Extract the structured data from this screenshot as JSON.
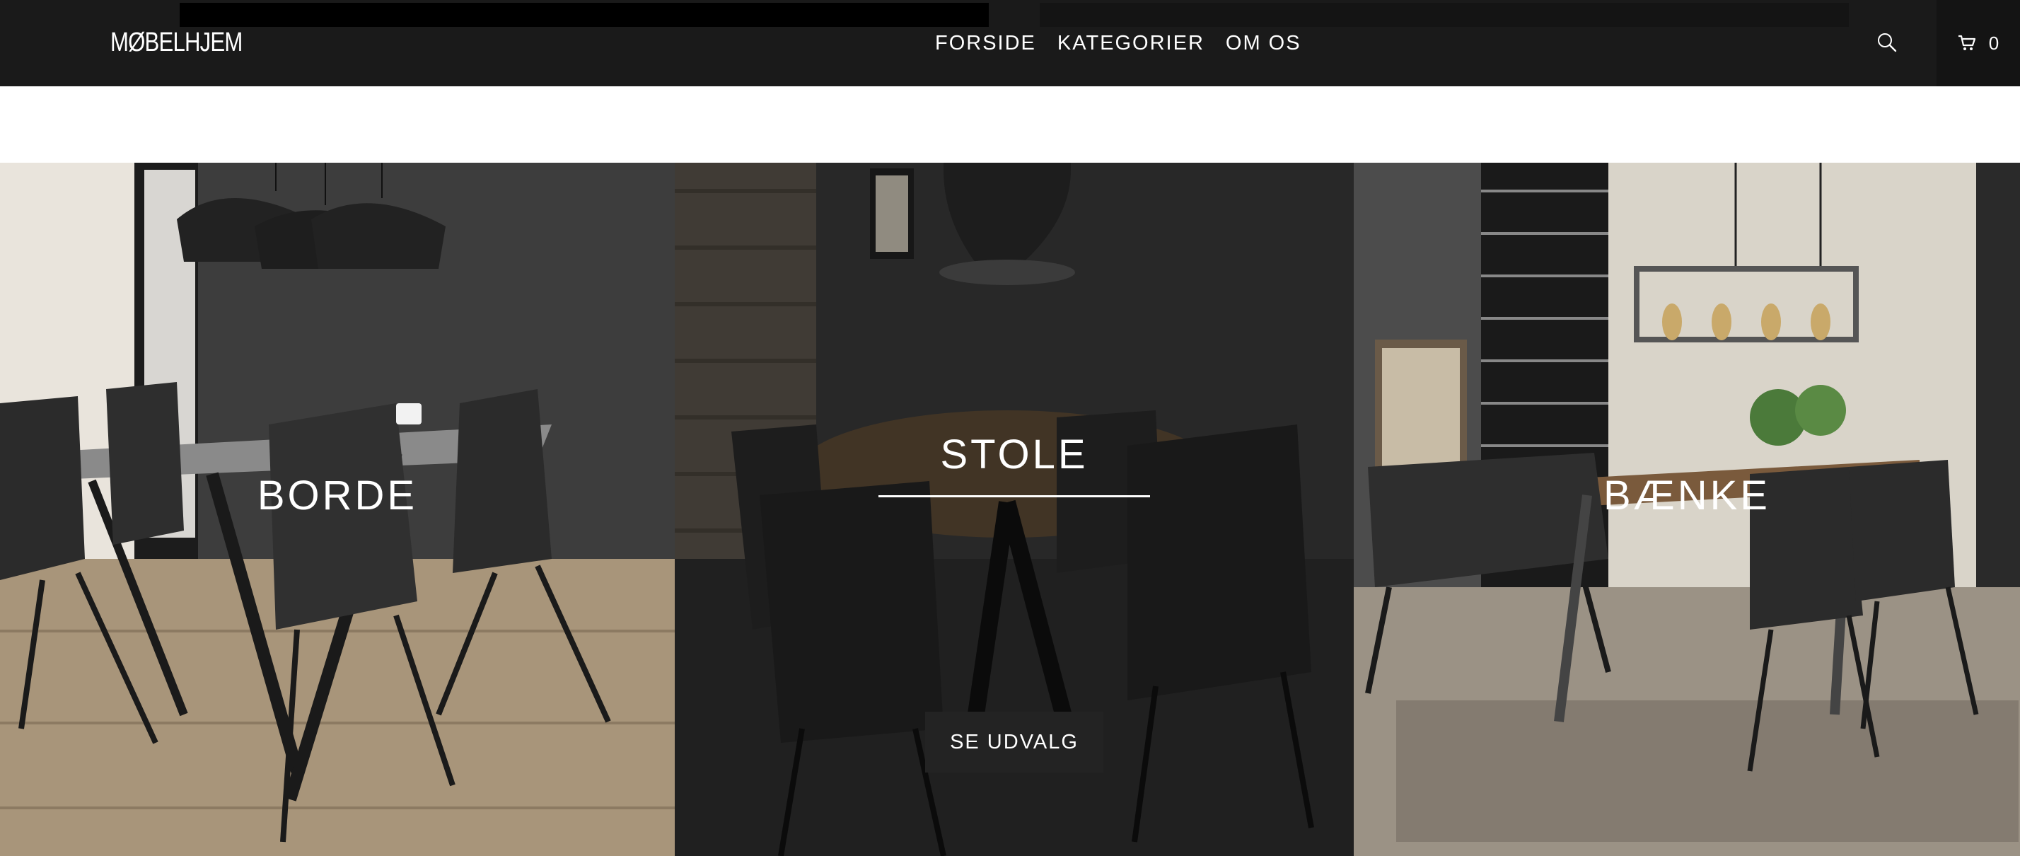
{
  "header": {
    "logo": "MØBELHJEM",
    "nav": [
      {
        "label": "FORSIDE"
      },
      {
        "label": "KATEGORIER"
      },
      {
        "label": "OM OS"
      }
    ],
    "search_icon": "search-icon",
    "cart_icon": "cart-icon",
    "cart_count": "0"
  },
  "categories": [
    {
      "title": "BORDE"
    },
    {
      "title": "STOLE",
      "button": "SE UDVALG"
    },
    {
      "title": "BÆNKE"
    }
  ],
  "colors": {
    "header_bg": "#1a1a1a",
    "text_on_dark": "#ffffff",
    "cta_bg": "#232323"
  }
}
